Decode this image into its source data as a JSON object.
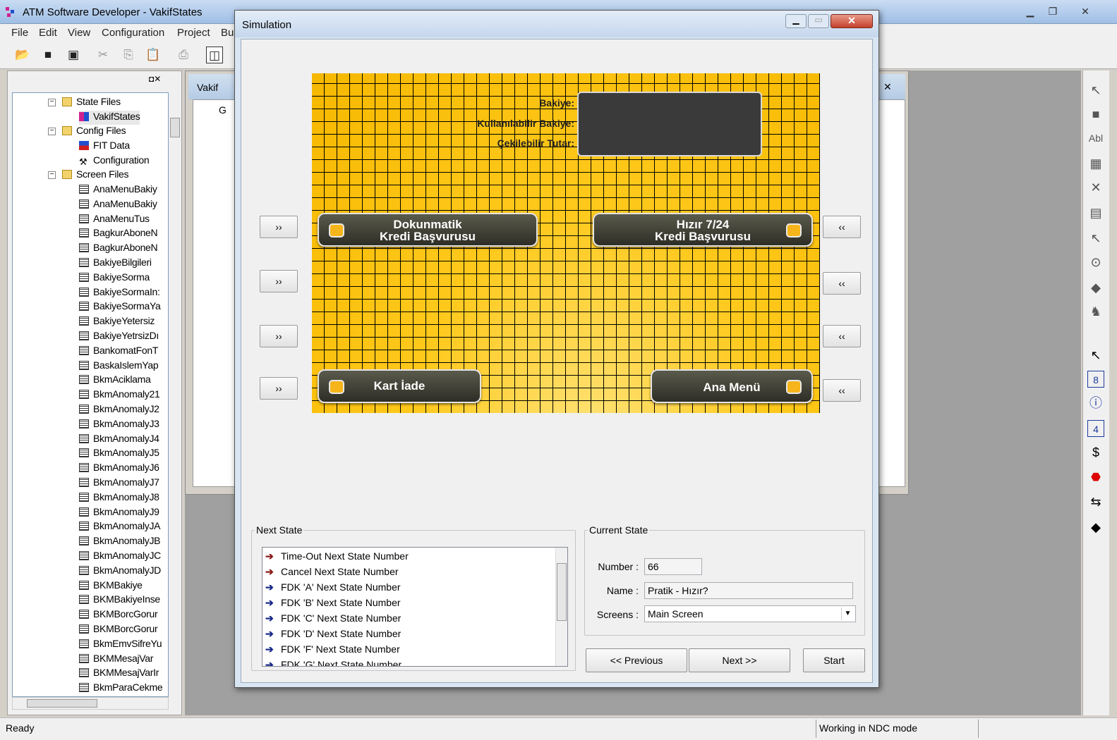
{
  "app": {
    "title": "ATM Software Developer - VakifStates"
  },
  "menu": [
    "File",
    "Edit",
    "View",
    "Configuration",
    "Project",
    "Bu"
  ],
  "tree": {
    "state_files": "State Files",
    "vakif_states": "VakifStates",
    "config_files": "Config Files",
    "fit_data": "FIT Data",
    "configuration": "Configuration",
    "screen_files": "Screen Files",
    "screens": [
      "AnaMenuBakiy",
      "AnaMenuBakiy",
      "AnaMenuTus",
      "BagkurAboneN",
      "BagkurAboneN",
      "BakiyeBilgileri",
      "BakiyeSorma",
      "BakiyeSormaIn:",
      "BakiyeSormaYa",
      "BakiyeYetersiz",
      "BakiyeYetrsizDı",
      "BankomatFonT",
      "BaskaIslemYap",
      "BkmAciklama",
      "BkmAnomaly21",
      "BkmAnomalyJ2",
      "BkmAnomalyJ3",
      "BkmAnomalyJ4",
      "BkmAnomalyJ5",
      "BkmAnomalyJ6",
      "BkmAnomalyJ7",
      "BkmAnomalyJ8",
      "BkmAnomalyJ9",
      "BkmAnomalyJA",
      "BkmAnomalyJB",
      "BkmAnomalyJC",
      "BkmAnomalyJD",
      "BKMBakiye",
      "BKMBakiyeInse",
      "BKMBorcGorur",
      "BKMBorcGorur",
      "BkmEmvSifreYu",
      "BKMMesajVar",
      "BKMMesajVarIr",
      "BkmParaCekme"
    ]
  },
  "child_window": {
    "title": "Vakif",
    "tree_root": "G"
  },
  "dialog": {
    "title": "Simulation"
  },
  "atm": {
    "balance_label": "Bakiye:",
    "usable_label": "Kullanılabilir Bakiye:",
    "withdrawable_label": "Çekilebilir Tutar:",
    "btn_touch_line1": "Dokunmatik",
    "btn_touch_line2": "Kredi Başvurusu",
    "btn_hizir_line1": "Hızır 7/24",
    "btn_hizir_line2": "Kredi Başvurusu",
    "btn_card": "Kart İade",
    "btn_menu": "Ana Menü",
    "fdk_left": "››",
    "fdk_right": "‹‹"
  },
  "next_state": {
    "legend": "Next State",
    "items": [
      {
        "label": "Time-Out Next State Number",
        "arrow": "➔",
        "color": "#8b1a1a"
      },
      {
        "label": "Cancel Next State Number",
        "arrow": "➔",
        "color": "#8b1a1a"
      },
      {
        "label": "FDK 'A' Next State Number",
        "arrow": "➔",
        "color": "#1a2a8b"
      },
      {
        "label": "FDK 'B' Next State Number",
        "arrow": "➔",
        "color": "#1a2a8b"
      },
      {
        "label": "FDK 'C' Next State Number",
        "arrow": "➔",
        "color": "#1a2a8b"
      },
      {
        "label": "FDK 'D' Next State Number",
        "arrow": "➔",
        "color": "#1a2a8b"
      },
      {
        "label": "FDK 'F' Next State Number",
        "arrow": "➔",
        "color": "#1a2a8b"
      },
      {
        "label": "FDK 'G' Next State Number",
        "arrow": "➔",
        "color": "#1a2a8b"
      }
    ]
  },
  "current_state": {
    "legend": "Current State",
    "number_label": "Number :",
    "number_value": "66",
    "name_label": "Name :",
    "name_value": "Pratik - Hızır?",
    "screens_label": "Screens :",
    "screens_value": "Main Screen"
  },
  "buttons": {
    "previous": "<< Previous",
    "next": "Next >>",
    "start": "Start"
  },
  "status": {
    "left": "Ready",
    "right": "Working in NDC mode"
  },
  "palette": {
    "text_tool": "Abl"
  }
}
